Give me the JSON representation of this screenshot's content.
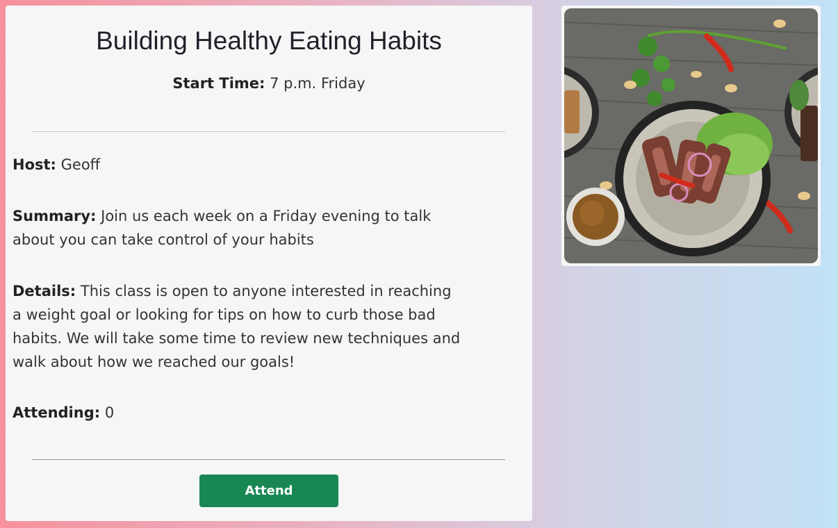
{
  "event": {
    "title": "Building Healthy Eating Habits",
    "start_time_label": "Start Time:",
    "start_time": "7 p.m. Friday",
    "host_label": "Host:",
    "host": "Geoff",
    "summary_label": "Summary:",
    "summary": "Join us each week on a Friday evening to talk about you can take control of your habits",
    "details_label": "Details:",
    "details": "This class is open to anyone interested in reaching a weight goal or looking for tips on how to curb those bad habits. We will take some time to review new techniques and walk about how we reached our goals!",
    "attending_label": "Attending:",
    "attending": "0",
    "attend_button": "Attend"
  },
  "colors": {
    "accent": "#198754",
    "card": "#f6f6f6"
  }
}
